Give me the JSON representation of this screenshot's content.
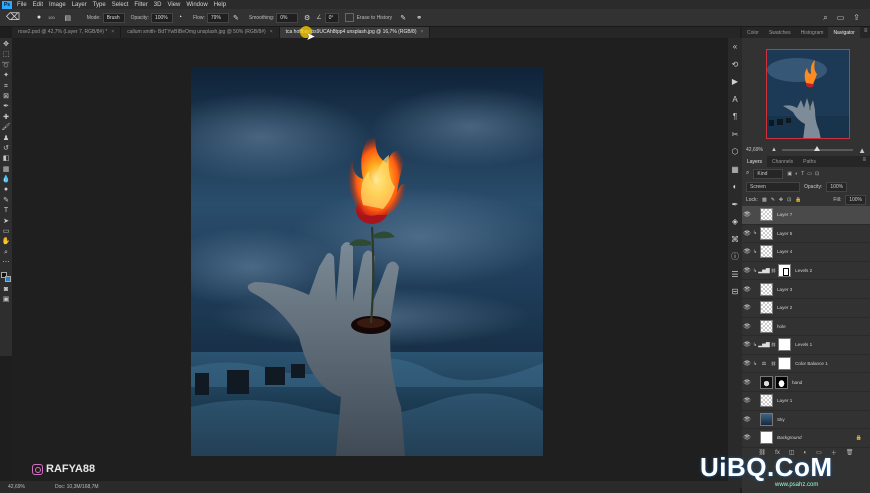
{
  "menubar": {
    "app_logo": "Ps",
    "items": [
      "File",
      "Edit",
      "Image",
      "Layer",
      "Type",
      "Select",
      "Filter",
      "3D",
      "View",
      "Window",
      "Help"
    ]
  },
  "options": {
    "mode_label": "Mode:",
    "mode_value": "Brush",
    "opacity_label": "Opacity:",
    "opacity_value": "100%",
    "flow_label": "Flow:",
    "flow_value": "79%",
    "smoothing_label": "Smoothing:",
    "smoothing_value": "0%",
    "angle_value": "0°",
    "erase_to_history": "Erase to History",
    "brush_size": "100"
  },
  "tabs": [
    {
      "label": "rose2.psd @ 42,7% (Layer 7, RGB/8#) *",
      "active": false
    },
    {
      "label": "callum smith- BdTYwBIBeOmg unsplash.jpg @ 50% (RGB/8#)",
      "active": false
    },
    {
      "label": "tca hoffbay bs9UCAh8tpp4 unsplash.jpg @ 16,7% (RGB/8)",
      "active": true
    }
  ],
  "status": {
    "zoom": "42,69%",
    "doc": "Doc: 10,3M/168,7M"
  },
  "watermark": {
    "handle": "RAFYA88",
    "site": "UiBQ.CoM",
    "site_sub": "www.psahz.com"
  },
  "panels": {
    "top_tabs": [
      "Color",
      "Swatches",
      "Histogram",
      "Navigator"
    ],
    "active_top_tab": "Navigator",
    "nav_zoom": "42,69%",
    "layer_tabs": [
      "Layers",
      "Channels",
      "Paths"
    ],
    "active_layer_tab": "Layers",
    "filter_kind": "Kind",
    "blend_mode": "Screen",
    "opacity_label": "Opacity:",
    "opacity_value": "100%",
    "lock_label": "Lock:",
    "fill_label": "Fill:",
    "fill_value": "100%"
  },
  "layers": [
    {
      "name": "Layer 7",
      "thumb": "checker",
      "selected": true,
      "clip": false,
      "adj": "",
      "mask": ""
    },
    {
      "name": "Layer 5",
      "thumb": "checker",
      "selected": false,
      "clip": true,
      "adj": "",
      "mask": ""
    },
    {
      "name": "Layer 4",
      "thumb": "checker",
      "selected": false,
      "clip": true,
      "adj": "",
      "mask": ""
    },
    {
      "name": "Levels 2",
      "thumb": "",
      "selected": false,
      "clip": true,
      "adj": "levels",
      "mask": "lvl"
    },
    {
      "name": "Layer 3",
      "thumb": "checker",
      "selected": false,
      "clip": false,
      "adj": "",
      "mask": ""
    },
    {
      "name": "Layer 2",
      "thumb": "checker",
      "selected": false,
      "clip": false,
      "adj": "",
      "mask": ""
    },
    {
      "name": "hole",
      "thumb": "checker",
      "selected": false,
      "clip": false,
      "adj": "",
      "mask": ""
    },
    {
      "name": "Levels 1",
      "thumb": "",
      "selected": false,
      "clip": true,
      "adj": "levels",
      "mask": "white"
    },
    {
      "name": "Color Balance 1",
      "thumb": "",
      "selected": false,
      "clip": true,
      "adj": "balance",
      "mask": "white"
    },
    {
      "name": "hand",
      "thumb": "photo",
      "selected": false,
      "clip": false,
      "adj": "",
      "mask": "dark"
    },
    {
      "name": "Layer 1",
      "thumb": "checker",
      "selected": false,
      "clip": false,
      "adj": "",
      "mask": ""
    },
    {
      "name": "Sky",
      "thumb": "sky",
      "selected": false,
      "clip": false,
      "adj": "",
      "mask": ""
    },
    {
      "name": "Background",
      "thumb": "white",
      "selected": false,
      "clip": false,
      "adj": "",
      "mask": "",
      "locked": true
    }
  ],
  "colors": {
    "accent": "#31a8ff",
    "fg_swatch": "#111111",
    "bg_swatch": "#2f79c7",
    "nav_frame": "#d0303a"
  }
}
